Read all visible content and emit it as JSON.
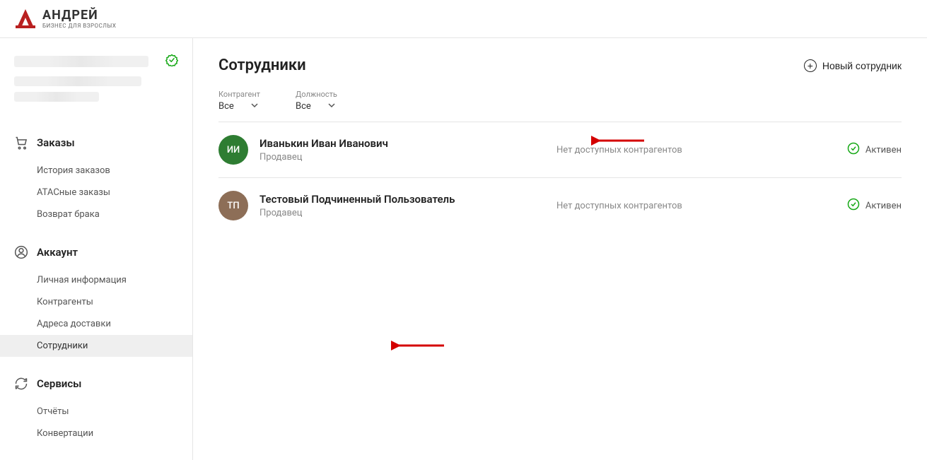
{
  "brand": {
    "name": "АНДРЕЙ",
    "tagline": "БИЗНЕС ДЛЯ ВЗРОСЛЫХ"
  },
  "sidebar": {
    "sections": [
      {
        "title": "Заказы",
        "icon": "cart",
        "items": [
          {
            "label": "История заказов"
          },
          {
            "label": "ATACные заказы"
          },
          {
            "label": "Возврат брака"
          }
        ]
      },
      {
        "title": "Аккаунт",
        "icon": "account",
        "items": [
          {
            "label": "Личная информация"
          },
          {
            "label": "Контрагенты"
          },
          {
            "label": "Адреса доставки"
          },
          {
            "label": "Сотрудники",
            "active": true
          }
        ]
      },
      {
        "title": "Сервисы",
        "icon": "services",
        "items": [
          {
            "label": "Отчёты"
          },
          {
            "label": "Конвертации"
          }
        ]
      }
    ]
  },
  "page": {
    "title": "Сотрудники",
    "new_button": "Новый сотрудник"
  },
  "filters": {
    "contractor": {
      "label": "Контрагент",
      "value": "Все"
    },
    "position": {
      "label": "Должность",
      "value": "Все"
    }
  },
  "employees": [
    {
      "initials": "ИИ",
      "avatar_color": "green",
      "name": "Иванькин Иван Иванович",
      "role": "Продавец",
      "contractors": "Нет доступных контрагентов",
      "status": "Активен"
    },
    {
      "initials": "ТП",
      "avatar_color": "brown",
      "name": "Тестовый Подчиненный Пользователь",
      "role": "Продавец",
      "contractors": "Нет доступных контрагентов",
      "status": "Активен"
    }
  ]
}
